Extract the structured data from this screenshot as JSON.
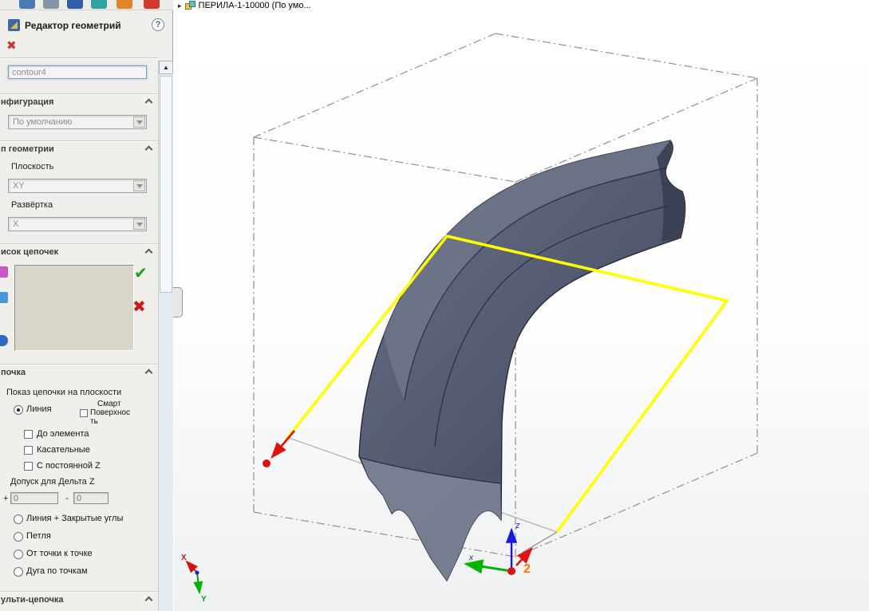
{
  "panel": {
    "title": "Редактор геометрий",
    "help": "?",
    "name_value": "contour4",
    "config_header": "нфигурация",
    "config_value": "По умолчанию",
    "geom_header": "п геометрии",
    "plane_label": "Плоскость",
    "plane_value": "XY",
    "unfold_label": "Развёртка",
    "unfold_value": "X",
    "chains_header": "исок цепочек",
    "chain_header": "почка",
    "show_label": "Показ цепочки на плоскости",
    "radio_line": "Линия",
    "smart1": "Смарт",
    "smart2": "Поверхнос",
    "smart3": "ть",
    "cb_to_element": "До элемента",
    "cb_tangent": "Касательные",
    "cb_const_z": "С постоянной Z",
    "tol_label": "Допуск для Дельта Z",
    "tol_plus_sign": "+",
    "tol_plus": "0",
    "tol_minus_sign": "-",
    "tol_minus": "0",
    "radio_line_corners": "Линия + Закрытые углы",
    "radio_loop": "Петля",
    "radio_p2p": "От точки к точке",
    "radio_arc": "Дуга по точкам",
    "multi_header": "ульти-цепочка"
  },
  "viewport": {
    "breadcrumb_arrow": "▸",
    "breadcrumb": "ПЕРИЛА-1-10000  (По умо...",
    "chain_number": "2",
    "axis_x_small": "x",
    "axis_z_small": "z",
    "axis_x": "X",
    "axis_y": "Y"
  },
  "icons": {
    "close_x": "✖",
    "confirm": "✔",
    "delete_x": "✖",
    "scroll_up": "▲"
  },
  "colors": {
    "chain_yellow": "#ffff00",
    "direction_red": "#e01212",
    "model_dark": "#3e4559",
    "model_light": "#6f7689",
    "bbox_gray": "#8f8f8f",
    "chain_number_orange": "#ff7700",
    "panel_bg": "#f1efeb"
  }
}
